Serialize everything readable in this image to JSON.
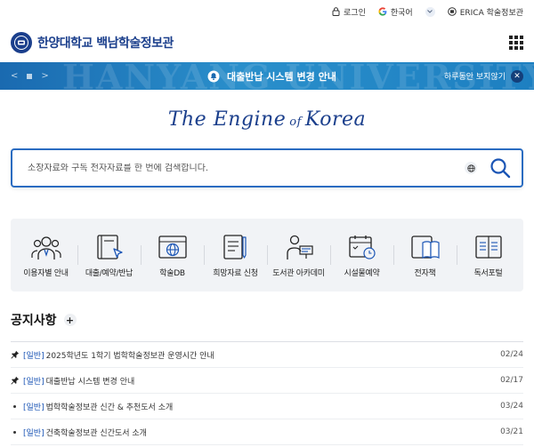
{
  "util": {
    "login": "로그인",
    "language": "한국어",
    "erica": "ERICA 학술정보관"
  },
  "header": {
    "logo_text": "한양대학교 백남학술정보관"
  },
  "banner": {
    "watermark": "HANYANG UNIVERSITY",
    "message": "대출반납 시스템 변경 안내",
    "dismiss": "하루동안 보지않기"
  },
  "slogan": {
    "part1": "The Engine",
    "part2": "of",
    "part3": "Korea"
  },
  "search": {
    "placeholder": "소장자료와 구독 전자자료를 한 번에 검색합니다."
  },
  "quick_menu": [
    {
      "label": "이용자별 안내",
      "icon": "users-icon"
    },
    {
      "label": "대출/예약/반납",
      "icon": "book-cursor-icon"
    },
    {
      "label": "학술DB",
      "icon": "web-globe-icon"
    },
    {
      "label": "희망자료 신청",
      "icon": "notebook-pen-icon"
    },
    {
      "label": "도서관 아카데미",
      "icon": "lecture-icon"
    },
    {
      "label": "시설물예약",
      "icon": "calendar-clock-icon"
    },
    {
      "label": "전자책",
      "icon": "ebook-icon"
    },
    {
      "label": "독서포털",
      "icon": "open-book-icon"
    }
  ],
  "notices": {
    "title": "공지사항",
    "items": [
      {
        "pinned": true,
        "category": "[일반]",
        "text": "2025학년도 1학기 법학학술정보관 운영시간 안내",
        "date": "02/24"
      },
      {
        "pinned": true,
        "category": "[일반]",
        "text": "대출반납 시스템 변경 안내",
        "date": "02/17"
      },
      {
        "pinned": false,
        "category": "[일반]",
        "text": "법학학술정보관 신간 & 추천도서 소개",
        "date": "03/24"
      },
      {
        "pinned": false,
        "category": "[일반]",
        "text": "건축학술정보관 신간도서 소개",
        "date": "03/21"
      }
    ]
  }
}
